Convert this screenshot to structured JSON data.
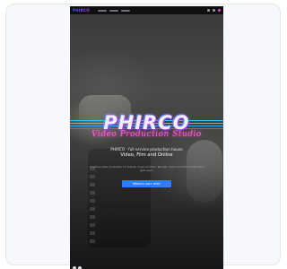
{
  "nav": {
    "brand": "PHIRCO",
    "items": [
      "",
      "",
      "",
      ""
    ]
  },
  "hero": {
    "logo_title": "PHIRCO",
    "logo_subtitle": "Video Production Studio",
    "tagline_line1": "PHIRCO · full service production house",
    "tagline_line2": "Video, Film and Online",
    "fine_print": "Creative video production for brands, music and film. We plan, shoot and edit content that gets seen.",
    "cta_label": "Watch our reel"
  },
  "colors": {
    "accent_blue": "#2e7cff",
    "neon_pink": "#ff5fd2",
    "neon_cyan": "#38c6ff"
  }
}
